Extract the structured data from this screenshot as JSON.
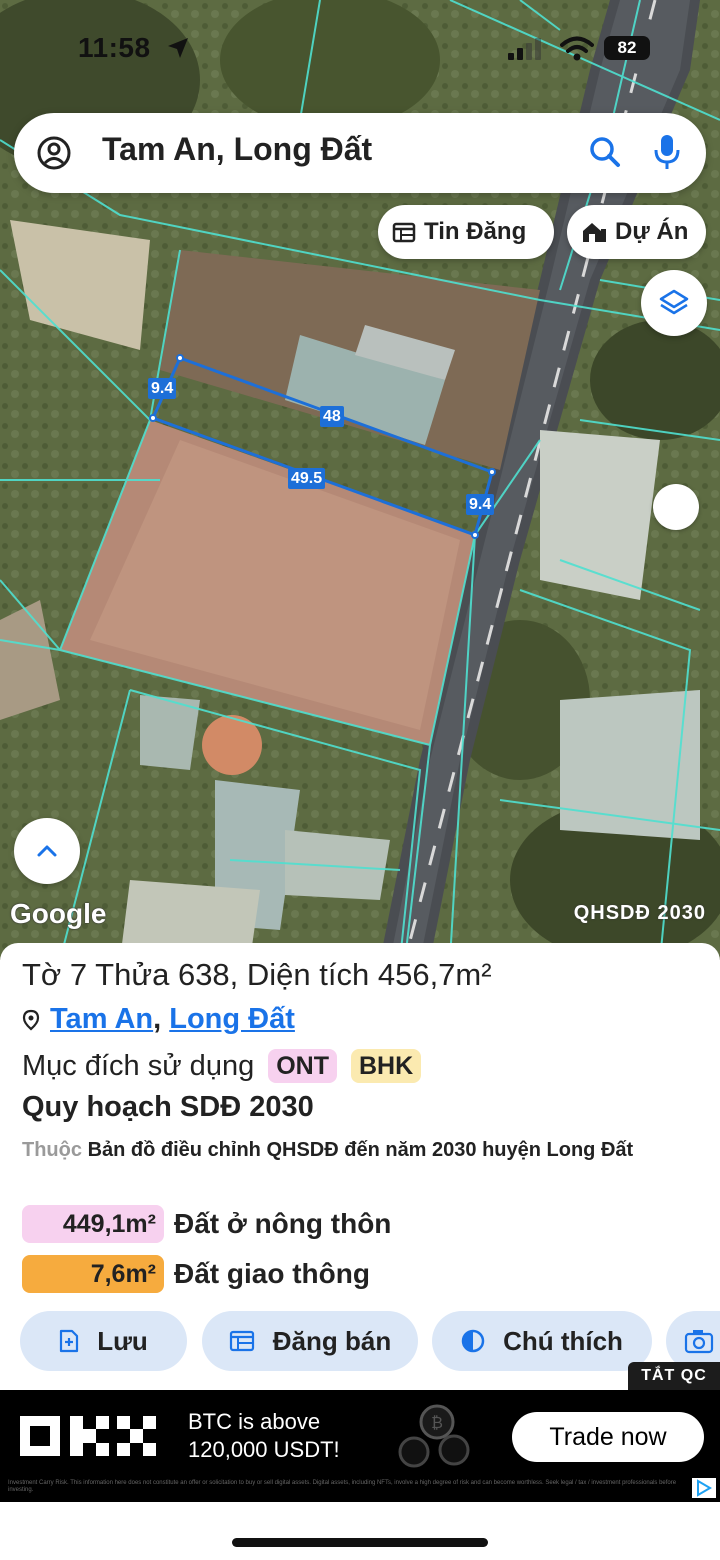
{
  "status_bar": {
    "time": "11:58",
    "battery": "82"
  },
  "search": {
    "query": "Tam An, Long Đất"
  },
  "map_chips": {
    "tin_dang": "Tin Đăng",
    "du_an": "Dự Án"
  },
  "map": {
    "plot_dimensions": [
      "9.4",
      "48",
      "49.5",
      "9.4"
    ],
    "attribution": "Google",
    "layer_label": "QHSDĐ 2030"
  },
  "parcel": {
    "title": "Tờ 7 Thửa 638, Diện tích 456,7m²",
    "location": {
      "commune": "Tam An",
      "district": "Long Đất",
      "separator": ","
    },
    "purpose_label": "Mục đích sử dụng",
    "purpose_codes": [
      {
        "code": "ONT",
        "color": "#f7d1ef"
      },
      {
        "code": "BHK",
        "color": "#fbeab0"
      }
    ],
    "plan_title": "Quy hoạch SDĐ 2030",
    "plan_prefix": "Thuộc",
    "plan_source": "Bản đồ điều chỉnh QHSDĐ đến năm 2030 huyện Long Đất",
    "areas": [
      {
        "value": "449,1m²",
        "label": "Đất ở nông thôn",
        "color": "#f7d1ef"
      },
      {
        "value": "7,6m²",
        "label": "Đất giao thông",
        "color": "#f6ab3e"
      }
    ]
  },
  "actions": {
    "save": "Lưu",
    "post_sale": "Đăng bán",
    "legend": "Chú thích"
  },
  "ad": {
    "close_label": "TẮT QC",
    "headline_line1": "BTC is above",
    "headline_line2": "120,000 USDT!",
    "cta": "Trade now",
    "disclaimer": "Investment Carry Risk. This information here does not constitute an offer or solicitation to buy or sell digital assets. Digital assets, including NFTs, involve a high degree of risk and can become worthless. Seek legal / tax / investment professionals before investing."
  }
}
